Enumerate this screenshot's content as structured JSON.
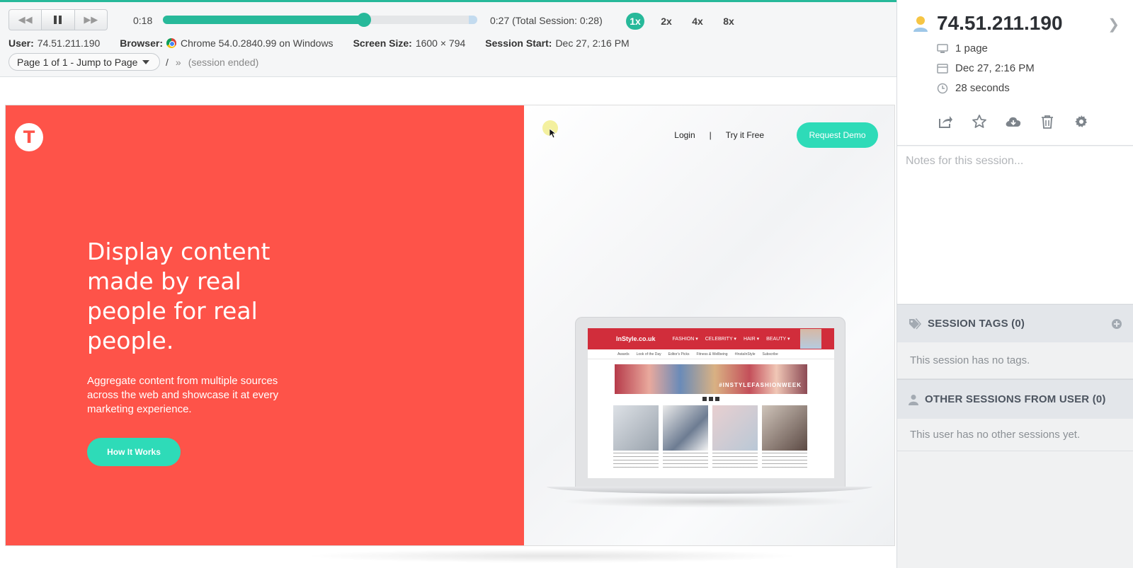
{
  "player": {
    "current_time": "0:18",
    "total_time": "0:27 (Total Session: 0:28)",
    "progress_fraction": 0.64,
    "speeds": [
      "1x",
      "2x",
      "4x",
      "8x"
    ],
    "active_speed": "1x",
    "accent_color": "#27b99a"
  },
  "meta": {
    "user_label": "User:",
    "user_value": "74.51.211.190",
    "browser_label": "Browser:",
    "browser_value": "Chrome 54.0.2840.99 on Windows",
    "screen_label": "Screen Size:",
    "screen_value": "1600 × 794",
    "start_label": "Session Start:",
    "start_value": "Dec 27, 2:16 PM"
  },
  "navigation": {
    "page_jump_label": "Page 1 of 1 - Jump to Page",
    "path": "/",
    "path_sep": "»",
    "status": "(session ended)"
  },
  "site": {
    "logo_letter": "T",
    "headline": "Display content made by real people for real people.",
    "subtext": "Aggregate content from multiple sources across the web and showcase it at every marketing experience.",
    "how_it_works": "How It Works",
    "login": "Login",
    "nav_sep": "|",
    "try_free": "Try it Free",
    "request_demo": "Request Demo",
    "hero_color": "#fe5349",
    "cta_color": "#2edbb8",
    "mockup": {
      "logo": "InStyle.co.uk",
      "menu": [
        "FASHION ▾",
        "CELEBRITY ▾",
        "HAIR ▾",
        "BEAUTY ▾"
      ],
      "subnav": [
        "Awards",
        "Look of the Day",
        "Editor's Picks",
        "Fitness & Wellbeing",
        "#InstaInStyle",
        "Subscribe"
      ],
      "banner_text": "#INSTYLEFASHIONWEEK"
    }
  },
  "sidebar": {
    "ip": "74.51.211.190",
    "pages": "1 page",
    "date": "Dec 27, 2:16 PM",
    "duration": "28 seconds",
    "notes_placeholder": "Notes for this session...",
    "tags_title": "SESSION TAGS (0)",
    "tags_empty": "This session has no tags.",
    "other_title": "OTHER SESSIONS FROM USER (0)",
    "other_empty": "This user has no other sessions yet."
  }
}
